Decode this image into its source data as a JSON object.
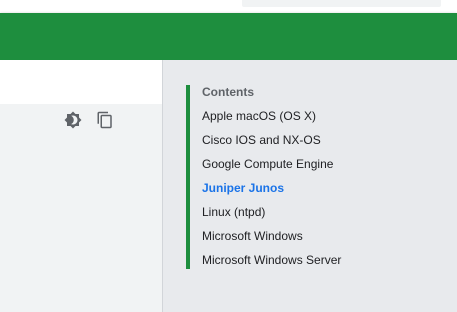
{
  "toc": {
    "title": "Contents",
    "items": [
      {
        "label": "Apple macOS (OS X)",
        "active": false
      },
      {
        "label": "Cisco IOS and NX-OS",
        "active": false
      },
      {
        "label": "Google Compute Engine",
        "active": false
      },
      {
        "label": "Juniper Junos",
        "active": true
      },
      {
        "label": "Linux (ntpd)",
        "active": false
      },
      {
        "label": "Microsoft Windows",
        "active": false
      },
      {
        "label": "Microsoft Windows Server",
        "active": false
      }
    ]
  },
  "colors": {
    "header_green": "#1e8e3e",
    "toc_accent": "#1e8e3e",
    "active_link": "#1a73e8",
    "code_background": "#f1f3f4",
    "sidebar_background": "#e8eaed"
  },
  "icons": {
    "theme_toggle": "brightness-icon",
    "copy": "copy-icon"
  }
}
